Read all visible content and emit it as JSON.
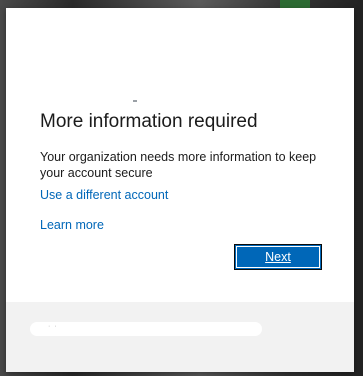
{
  "dialog": {
    "title": "More information required",
    "description": "Your organization needs more information to keep your account secure",
    "use_different_account_link": "Use a different account",
    "learn_more_link": "Learn more",
    "next_button": "Next"
  },
  "footer": {
    "redacted_text": "· ·"
  },
  "colors": {
    "accent": "#0067b8",
    "card_background": "#ffffff",
    "footer_background": "#f2f2f2"
  }
}
